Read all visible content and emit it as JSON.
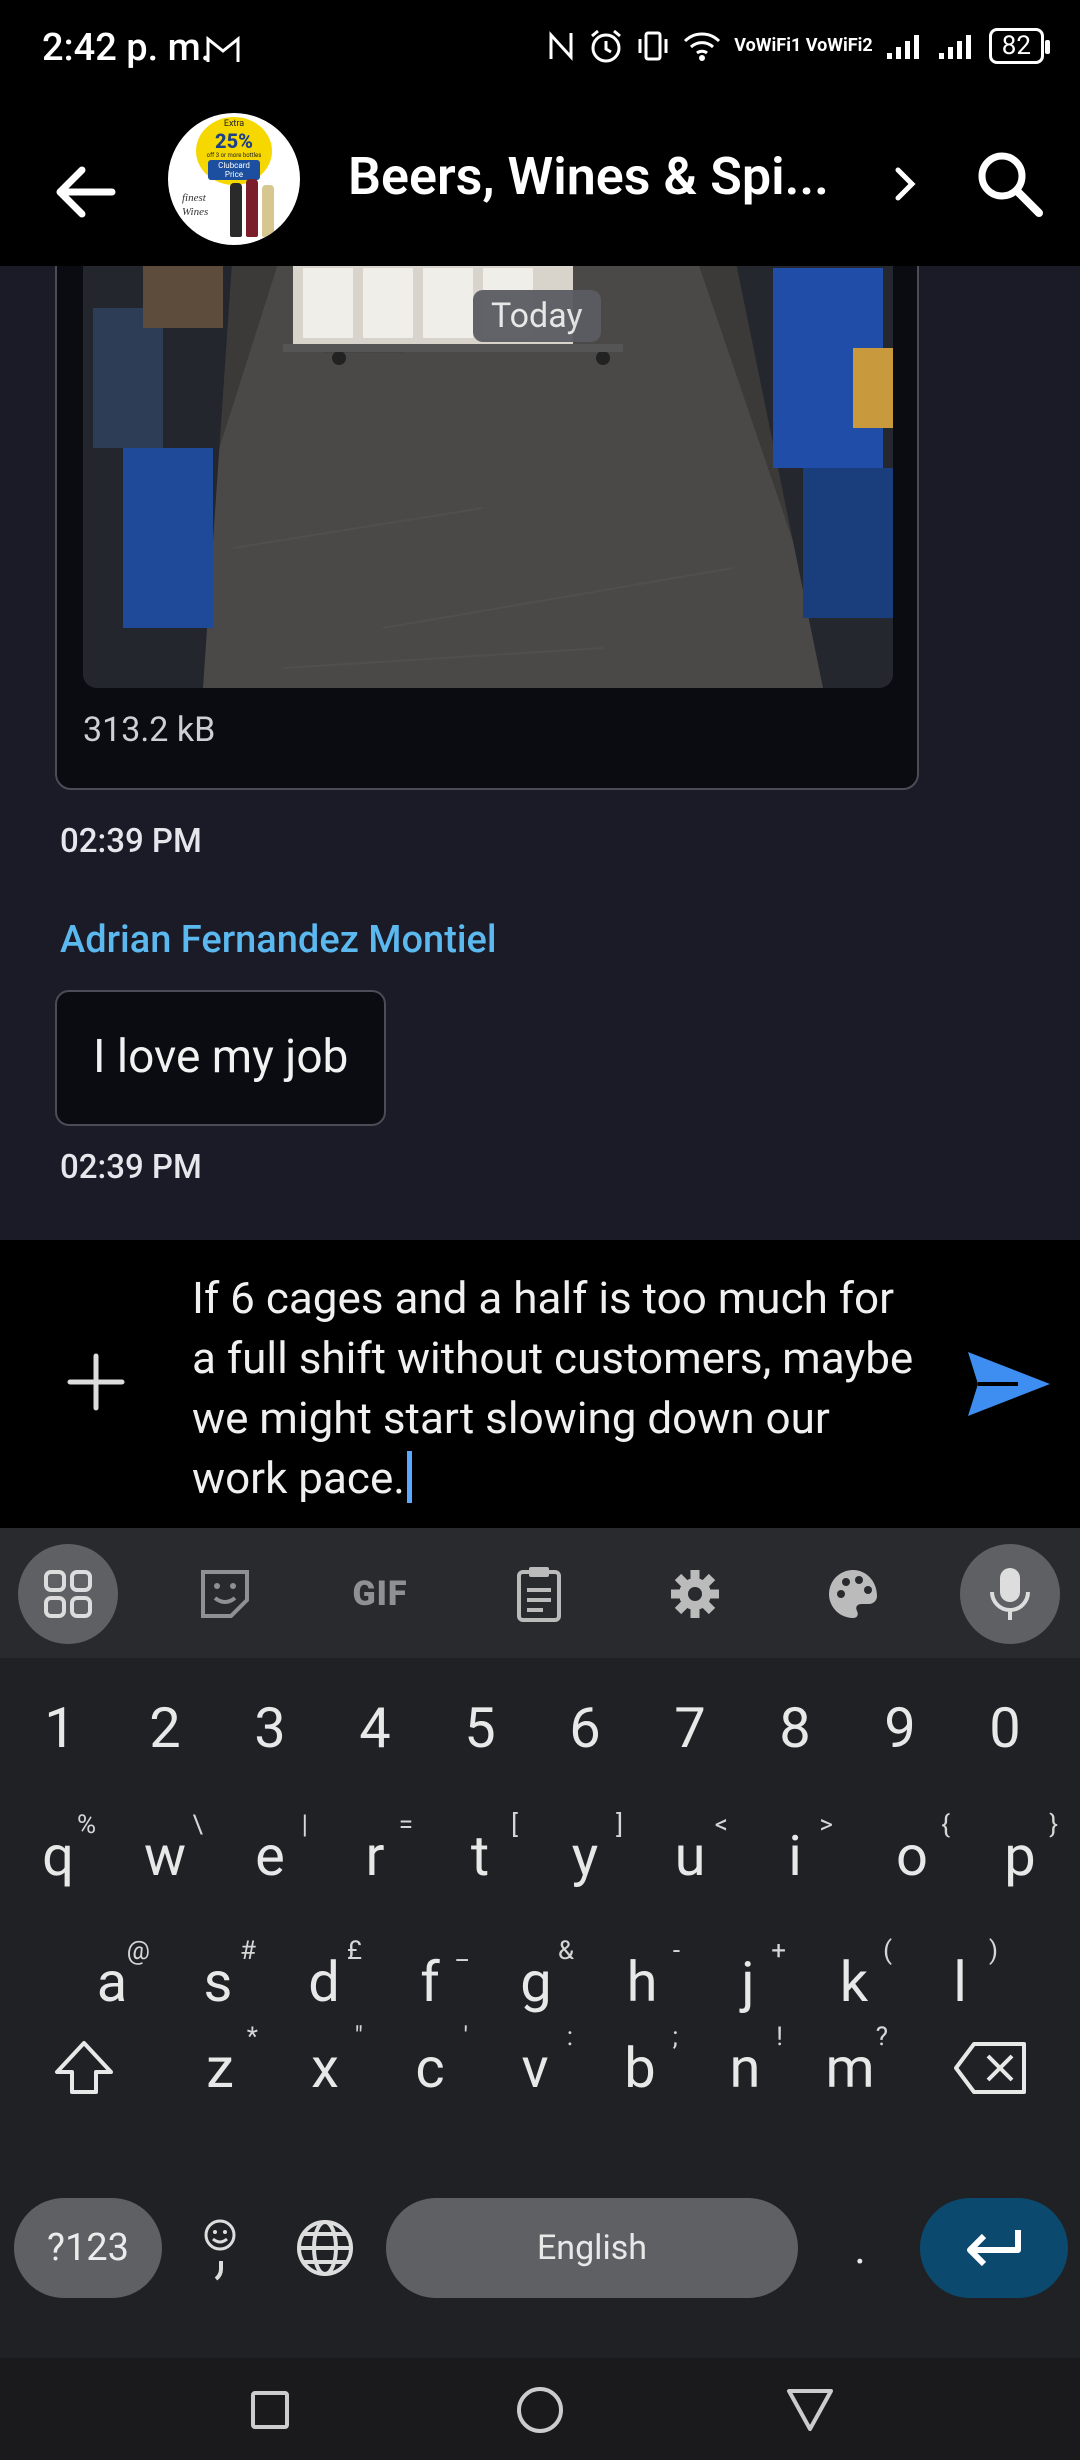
{
  "status_bar": {
    "time": "2:42 p. m.",
    "net_labels": "VoWiFi1 VoWiFi2",
    "battery": "82"
  },
  "header": {
    "title": "Beers, Wines & Spi...",
    "avatar": {
      "line1": "Extra",
      "line2": "25%",
      "line3": "off 3 or more bottles",
      "line4": "Clubcard",
      "line5": "Price",
      "brand": "finest Wines"
    }
  },
  "chat": {
    "image_message": {
      "overlay": "Today",
      "file_size": "313.2 kB",
      "time": "02:39 PM"
    },
    "text_message": {
      "sender": "Adrian Fernandez Montiel",
      "text": "I love my job",
      "time": "02:39 PM"
    }
  },
  "composer": {
    "text": "If 6 cages and a half is too much for a full shift without customers, maybe we might start slowing down our work pace."
  },
  "keyboard": {
    "toolbar": {
      "gif_label": "GIF"
    },
    "numbers": [
      "1",
      "2",
      "3",
      "4",
      "5",
      "6",
      "7",
      "8",
      "9",
      "0"
    ],
    "row1": [
      {
        "k": "q",
        "a": "%"
      },
      {
        "k": "w",
        "a": "\\"
      },
      {
        "k": "e",
        "a": "|"
      },
      {
        "k": "r",
        "a": "="
      },
      {
        "k": "t",
        "a": "["
      },
      {
        "k": "y",
        "a": "]"
      },
      {
        "k": "u",
        "a": "<"
      },
      {
        "k": "i",
        "a": ">"
      },
      {
        "k": "o",
        "a": "{"
      },
      {
        "k": "p",
        "a": "}"
      }
    ],
    "row2": [
      {
        "k": "a",
        "a": "@"
      },
      {
        "k": "s",
        "a": "#"
      },
      {
        "k": "d",
        "a": "£"
      },
      {
        "k": "f",
        "a": "_"
      },
      {
        "k": "g",
        "a": "&"
      },
      {
        "k": "h",
        "a": "-"
      },
      {
        "k": "j",
        "a": "+"
      },
      {
        "k": "k",
        "a": "("
      },
      {
        "k": "l",
        "a": ")"
      }
    ],
    "row3": [
      {
        "k": "z",
        "a": "*"
      },
      {
        "k": "x",
        "a": "\""
      },
      {
        "k": "c",
        "a": "'"
      },
      {
        "k": "v",
        "a": ":"
      },
      {
        "k": "b",
        "a": ";"
      },
      {
        "k": "n",
        "a": "!"
      },
      {
        "k": "m",
        "a": "?"
      }
    ],
    "symbols_label": "?123",
    "space_label": "English",
    "period": "."
  },
  "colors": {
    "accent": "#5bb9f0",
    "send": "#3d8ef0",
    "enter": "#0b4a6e"
  }
}
